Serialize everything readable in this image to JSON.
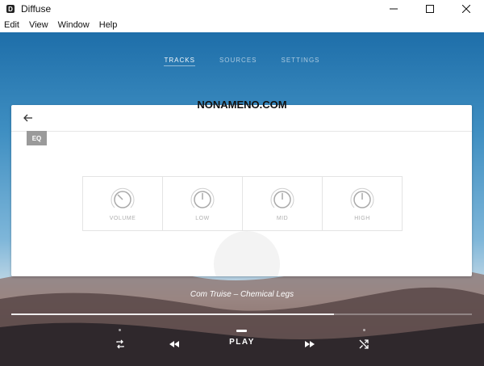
{
  "window": {
    "title": "Diffuse",
    "app_icon_glyph": "D",
    "controls": [
      "minimize-icon",
      "maximize-icon",
      "close-icon"
    ]
  },
  "menu": {
    "items": [
      "Edit",
      "View",
      "Window",
      "Help"
    ]
  },
  "nav": {
    "tabs": [
      {
        "label": "TRACKS",
        "active": true
      },
      {
        "label": "SOURCES",
        "active": false
      },
      {
        "label": "SETTINGS",
        "active": false
      }
    ]
  },
  "watermark": "NONAMENO.COM",
  "eq_panel": {
    "back_icon": "arrow-left-icon",
    "badge": "EQ",
    "knobs": [
      {
        "label": "VOLUME"
      },
      {
        "label": "LOW"
      },
      {
        "label": "MID"
      },
      {
        "label": "HIGH"
      }
    ]
  },
  "player": {
    "now_playing": "Com Truise – Chemical Legs",
    "play_label": "PLAY",
    "progress": 0.7,
    "icons": [
      "repeat-icon",
      "rewind-icon",
      "fast-forward-icon",
      "shuffle-icon"
    ]
  },
  "colors": {
    "sky_top": "#1e6ea9",
    "panel_bg": "#ffffff",
    "badge_bg": "#9a9a9a"
  }
}
